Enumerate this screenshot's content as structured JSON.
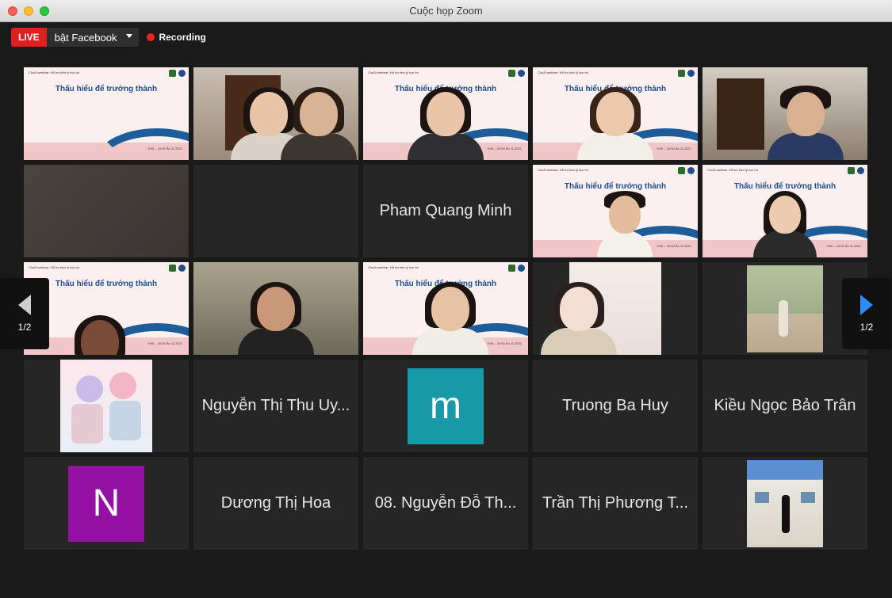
{
  "window": {
    "title": "Cuộc họp Zoom"
  },
  "toolbar": {
    "live_label": "LIVE",
    "live_destination": "bật Facebook",
    "recording_label": "Recording"
  },
  "slide": {
    "title": "Thấu hiểu để trưởng thành",
    "small_text": "Chuỗi webinar: Hỗ trợ tâm lý học trò",
    "date_text": "9:00 – 10:00 Ấn 11.2021"
  },
  "participants": {
    "name_pham": "Pham Quang Minh",
    "name_uyen": "Nguyễn Thị Thu Uy...",
    "avatar_m": "m",
    "name_huy": "Truong Ba Huy",
    "name_tran": "Kiều Ngọc Bảo Trân",
    "avatar_n": "N",
    "name_hoa": "Dương Thị Hoa",
    "name_08": "08. Nguyễn Đỗ Th...",
    "name_phuong": "Trần Thị Phương T..."
  },
  "pagination": {
    "left_label": "1/2",
    "right_label": "1/2"
  },
  "colors": {
    "avatar_m": "#1899a8",
    "avatar_n": "#9410a3",
    "active_border": "#b5e08a",
    "live": "#e02020"
  },
  "icons": {
    "prev": "arrow-left-icon",
    "next": "arrow-right-icon",
    "rec": "record-dot-icon"
  }
}
